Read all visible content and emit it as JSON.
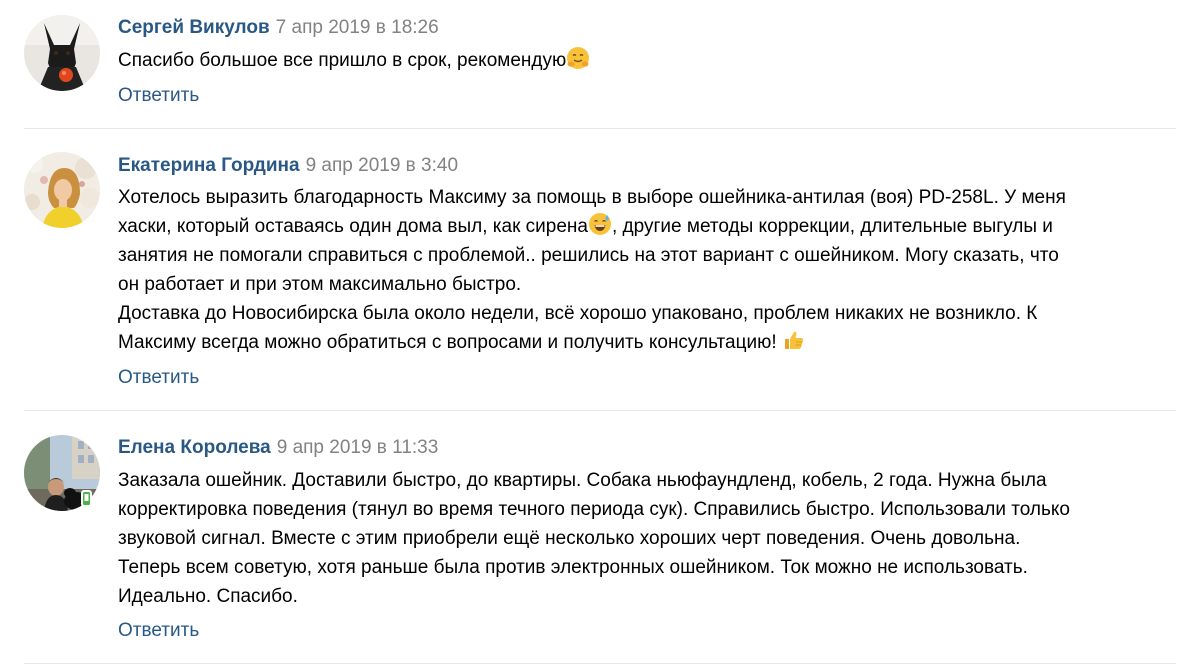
{
  "comments": [
    {
      "author": "Сергей Викулов",
      "date": "7 апр 2019 в 18:26",
      "lines": [
        {
          "parts": [
            "Спасибо большое все пришло в срок, рекомендую",
            ""
          ],
          "emoji": "hugging-face-emoji"
        }
      ],
      "reply_label": "Ответить",
      "avatar_icon": "user-avatar-dog"
    },
    {
      "author": "Екатерина Гордина",
      "date": "9 апр 2019 в 3:40",
      "lines": [
        {
          "parts": [
            "Хотелось выразить благодарность Максиму за помощь в выборе ошейника-антилая (воя) PD-258L. У меня",
            ""
          ]
        },
        {
          "parts": [
            "хаски, который оставаясь один дома выл, как сирена",
            ", другие методы коррекции, длительные выгулы и"
          ],
          "emoji": "grinning-sweat-emoji"
        },
        {
          "parts": [
            "занятия не помогали справиться с проблемой.. решились на этот вариант с ошейником. Могу сказать, что",
            ""
          ]
        },
        {
          "parts": [
            "он работает и при этом максимально быстро.",
            ""
          ]
        },
        {
          "parts": [
            "Доставка до Новосибирска была около недели, всё хорошо упаковано, проблем никаких не возникло. К",
            ""
          ]
        },
        {
          "parts": [
            "Максиму всегда можно обратиться с вопросами и получить консультацию! ",
            ""
          ],
          "emoji": "thumbs-up-emoji"
        }
      ],
      "reply_label": "Ответить",
      "avatar_icon": "user-avatar-woman-flowers"
    },
    {
      "author": "Елена Королева",
      "date": "9 апр 2019 в 11:33",
      "lines": [
        {
          "parts": [
            "Заказала ошейник. Доставили быстро, до квартиры. Собака ньюфаундленд, кобель, 2 года. Нужна была",
            ""
          ]
        },
        {
          "parts": [
            "корректировка поведения (тянул во время течного периода сук). Справились быстро. Использовали только",
            ""
          ]
        },
        {
          "parts": [
            "звуковой сигнал. Вместе с этим приобрели ещё несколько хороших черт поведения. Очень довольна.",
            ""
          ]
        },
        {
          "parts": [
            "Теперь всем советую, хотя раньше была против электронных ошейником. Ток можно не использовать.",
            ""
          ]
        },
        {
          "parts": [
            "Идеально. Спасибо.",
            ""
          ]
        }
      ],
      "reply_label": "Ответить",
      "avatar_icon": "user-avatar-woman-dog",
      "online_badge": "mobile-online-icon"
    }
  ],
  "colors": {
    "link": "#2a5885",
    "muted": "#828282",
    "divider": "#e7e8ec"
  }
}
